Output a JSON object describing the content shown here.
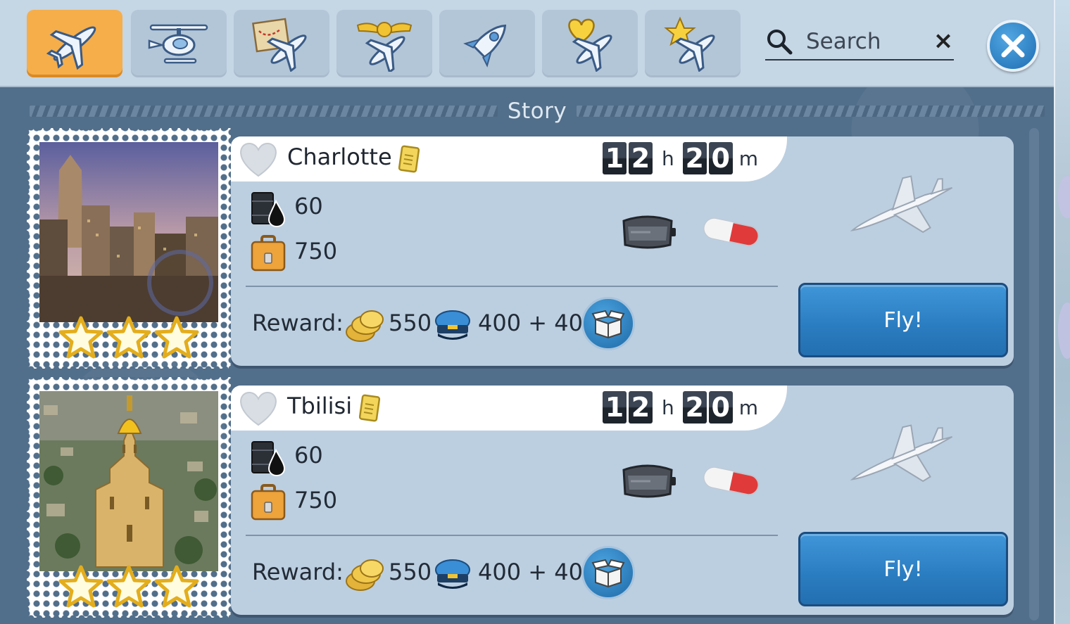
{
  "search": {
    "placeholder": "Search"
  },
  "tabs": [
    {
      "name": "tab-all-planes",
      "icon": "plane-icon",
      "active": true
    },
    {
      "name": "tab-helicopters",
      "icon": "helicopter-icon",
      "active": false
    },
    {
      "name": "tab-story",
      "icon": "map-plane-icon",
      "active": false
    },
    {
      "name": "tab-ranked",
      "icon": "winged-badge-plane-icon",
      "active": false
    },
    {
      "name": "tab-rockets",
      "icon": "rocket-icon",
      "active": false
    },
    {
      "name": "tab-favorites",
      "icon": "heart-plane-icon",
      "active": false
    },
    {
      "name": "tab-special",
      "icon": "star-plane-icon",
      "active": false
    }
  ],
  "section": {
    "title": "Story"
  },
  "missions": [
    {
      "city": "Charlotte",
      "timer": {
        "h1": "1",
        "h2": "2",
        "h_unit": "h",
        "m1": "2",
        "m2": "0",
        "m_unit": "m"
      },
      "fuel": "60",
      "cargo": "750",
      "reward_label": "Reward:",
      "reward_coins": "550",
      "reward_xp": "400 + 40",
      "fly_label": "Fly!",
      "stars": 3
    },
    {
      "city": "Tbilisi",
      "timer": {
        "h1": "1",
        "h2": "2",
        "h_unit": "h",
        "m1": "2",
        "m2": "0",
        "m_unit": "m"
      },
      "fuel": "60",
      "cargo": "750",
      "reward_label": "Reward:",
      "reward_coins": "550",
      "reward_xp": "400 + 40",
      "fly_label": "Fly!",
      "stars": 3
    }
  ],
  "colors": {
    "active_tab": "#f5ae4a",
    "fly_button": "#2a7cc0",
    "panel": "#bccfe1",
    "background": "#516e8a"
  }
}
